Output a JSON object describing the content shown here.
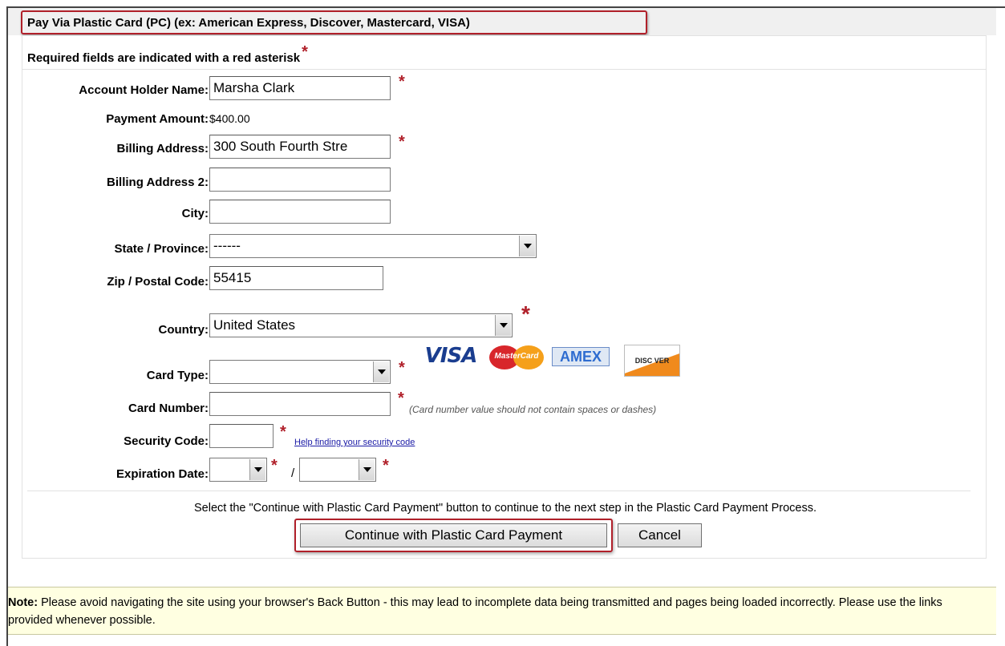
{
  "panel": {
    "title": "Pay Via Plastic Card (PC) (ex: American Express, Discover, Mastercard, VISA)",
    "required_note": "Required fields are indicated with a red asterisk",
    "required_marker": "*"
  },
  "fields": {
    "account_holder": {
      "label": "Account Holder Name:",
      "value": "Marsha Clark"
    },
    "payment_amount": {
      "label": "Payment Amount:",
      "value": "$400.00"
    },
    "billing_address": {
      "label": "Billing Address:",
      "value": "300 South Fourth Stre"
    },
    "billing_address2": {
      "label": "Billing Address 2:",
      "value": ""
    },
    "city": {
      "label": "City:",
      "value": ""
    },
    "state": {
      "label": "State / Province:",
      "selected": "------"
    },
    "zip": {
      "label": "Zip / Postal Code:",
      "value": "55415"
    },
    "country": {
      "label": "Country:",
      "selected": "United States"
    },
    "card_type": {
      "label": "Card Type:",
      "selected": ""
    },
    "card_number": {
      "label": "Card Number:",
      "value": "",
      "hint": "(Card number value should not contain spaces or dashes)"
    },
    "security_code": {
      "label": "Security Code:",
      "value": "",
      "help_link": "Help finding your security code"
    },
    "expiration": {
      "label": "Expiration Date:",
      "month": "",
      "year": "",
      "separator": "/"
    }
  },
  "card_logos": {
    "visa": "VISA",
    "mastercard": "MasterCard",
    "amex": "AMEX",
    "discover": "DISC VER"
  },
  "instructions": "Select the \"Continue with Plastic Card Payment\" button to continue to the next step in the Plastic Card Payment Process.",
  "buttons": {
    "continue": "Continue with Plastic Card Payment",
    "cancel": "Cancel"
  },
  "note": {
    "label": "Note:",
    "text": " Please avoid navigating the site using your browser's Back Button - this may lead to incomplete data being transmitted and pages being loaded incorrectly. Please use the links provided whenever possible."
  },
  "colors": {
    "required_red": "#b0202a",
    "note_background": "#ffffe1",
    "link_blue": "#1a1aa6"
  }
}
